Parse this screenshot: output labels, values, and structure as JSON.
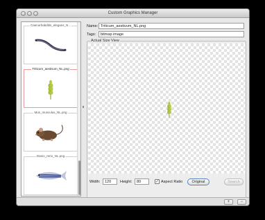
{
  "window": {
    "title": "Custom Graphics Manager"
  },
  "list": {
    "items": [
      {
        "caption": "Caenorhabditis_elegans_N...",
        "icon": "worm-icon",
        "selected": false
      },
      {
        "caption": "Triticum_aestivum_NL.png",
        "icon": "wheat-icon",
        "selected": true
      },
      {
        "caption": "Mus_musculus_NL.png",
        "icon": "mouse-icon",
        "selected": false
      },
      {
        "caption": "Danio_rerio_NL.png",
        "icon": "zebrafish-icon",
        "selected": false
      }
    ]
  },
  "form": {
    "name_label": "Name:",
    "name_value": "Triticum_aestivum_NL.png",
    "tags_label": "Tags:",
    "tags_value": "bitmap image"
  },
  "preview": {
    "group_title": "Actual Size View",
    "image_icon": "wheat-icon"
  },
  "size": {
    "width_label": "Width:",
    "width_value": "120",
    "height_label": "Height:",
    "height_value": "80",
    "aspect_label": "Aspect Ratio",
    "aspect_checked": "✓",
    "original_label": "Original",
    "search_label": "Search"
  },
  "footer": {
    "add_label": "+",
    "remove_label": "−"
  },
  "colors": {
    "selected_border": "#e79a9a",
    "checkmark": "#1a4fa8"
  }
}
